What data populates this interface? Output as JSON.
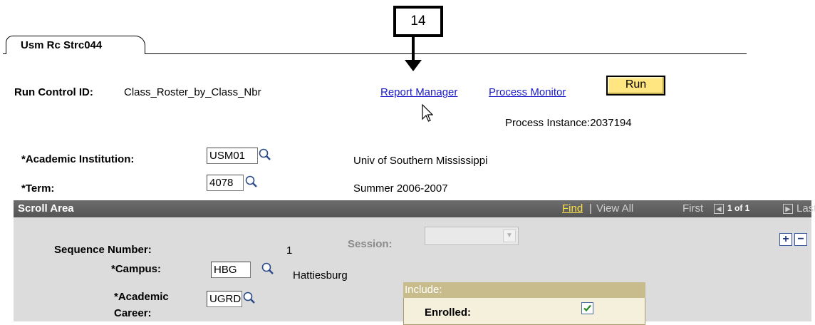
{
  "annotation": {
    "number": "14"
  },
  "tab": {
    "label": "Usm Rc Strc044"
  },
  "run_control": {
    "label": "Run Control ID:",
    "value": "Class_Roster_by_Class_Nbr",
    "report_manager": "Report Manager",
    "process_monitor": "Process Monitor",
    "run_label": "Run",
    "process_instance": "Process Instance:2037194"
  },
  "institution": {
    "label": "*Academic Institution:",
    "value": "USM01",
    "description": "Univ of Southern Mississippi"
  },
  "term": {
    "label": "*Term:",
    "value": "4078",
    "description": "Summer 2006-2007"
  },
  "scroll_area": {
    "title": "Scroll Area",
    "find": "Find",
    "separator": "|",
    "view_all": "View All",
    "first": "First",
    "count": "1 of 1",
    "last": "Last",
    "prev_glyph": "◀",
    "next_glyph": "▶",
    "add_glyph": "+",
    "delete_glyph": "−"
  },
  "sequence": {
    "label": "Sequence Number:",
    "value": "1"
  },
  "session": {
    "label": "Session:",
    "value": ""
  },
  "campus": {
    "label": "*Campus:",
    "value": "HBG",
    "description": "Hattiesburg"
  },
  "career": {
    "label_line1": "*Academic",
    "label_line2": "Career:",
    "value": "UGRD"
  },
  "include": {
    "header": "Include:",
    "enrolled_label": "Enrolled:",
    "enrolled_checked": true
  },
  "icons": {
    "lookup": "magnifier-icon",
    "cursor": "mouse-pointer-icon",
    "arrow": "down-arrow-icon"
  },
  "colors": {
    "link": "#1a1ac8",
    "run_button": "#ffe680",
    "scroll_header": "#5f5f5f",
    "find_link": "#ffe14a",
    "include_header": "#c8bc8c"
  }
}
